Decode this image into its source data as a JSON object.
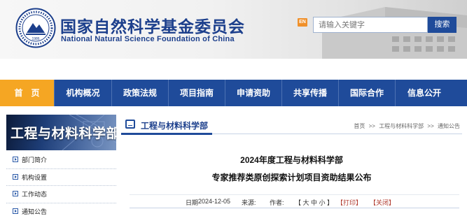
{
  "header": {
    "site_title_zh": "国家自然科学基金委员会",
    "site_title_en": "National Natural Science Foundation of China",
    "seal_year": "1986",
    "en_switch": "EN",
    "search_placeholder": "请输入关键字",
    "search_button": "搜索"
  },
  "nav": {
    "items": [
      "首　页",
      "机构概况",
      "政策法规",
      "项目指南",
      "申请资助",
      "共享传播",
      "国际合作",
      "信息公开"
    ],
    "active_index": 0
  },
  "sidebar": {
    "banner_title": "工程与材料科学部",
    "items": [
      "部门简介",
      "机构设置",
      "工作动态",
      "通知公告"
    ]
  },
  "section": {
    "title": "工程与材料科学部",
    "breadcrumb": [
      "首页",
      ">>",
      "工程与材料科学部",
      ">>",
      "通知公告"
    ]
  },
  "article": {
    "title_line1": "2024年度工程与材料科学部",
    "title_line2": "专家推荐类原创探索计划项目资助结果公布",
    "date_label": "日期",
    "date": "2024-12-05",
    "source_label": "来源:",
    "author_label": "作者:",
    "font_size_controls": "【 大 中 小 】",
    "print_label": "【打印】",
    "close_label": "【关闭】"
  },
  "colors": {
    "brand_blue": "#1f4b9a",
    "nav_active": "#f5a623"
  }
}
